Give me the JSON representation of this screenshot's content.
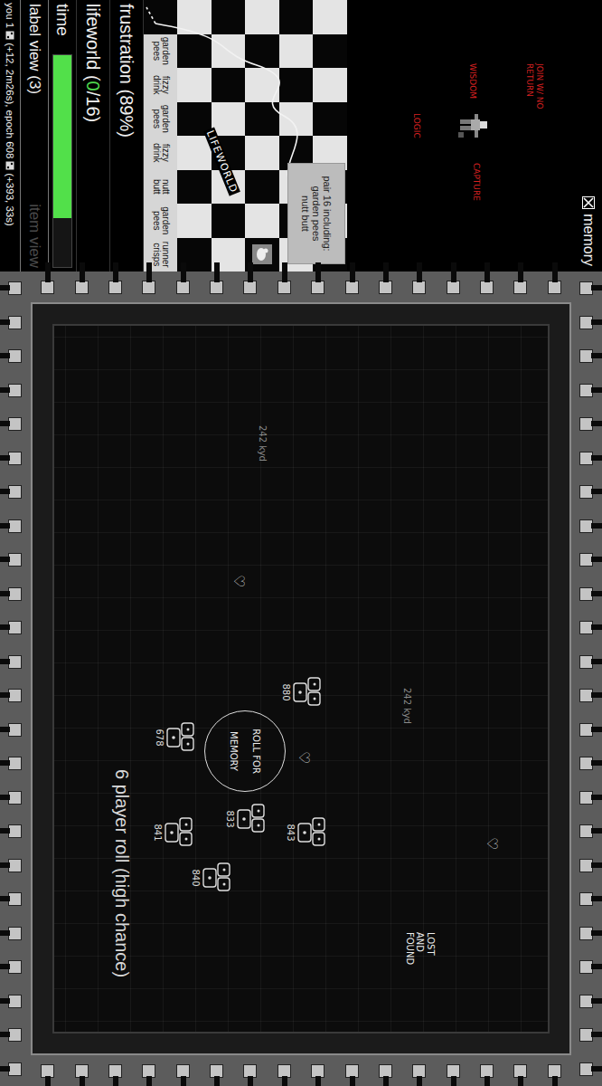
{
  "status": {
    "name": "you",
    "score": "1",
    "score_detail": "(+12, 2m26s), epoch",
    "epoch": "608",
    "epoch_detail": "(+393, 33s)"
  },
  "views": [
    {
      "label": "label view (3)",
      "selected": true
    },
    {
      "label": "item view",
      "selected": false
    }
  ],
  "time": {
    "label": "time",
    "level": 0.77
  },
  "lifeworld": {
    "prefix": "lifeworld (",
    "count": "0",
    "suffix": "/16)"
  },
  "frustration": {
    "label": "frustration (89%)"
  },
  "board": {
    "items": [
      "garden pees",
      "fizzy drink",
      "garden pees",
      "fizzy drink",
      "nutt butt",
      "garden pees",
      "runner crisps"
    ],
    "tooltip": {
      "title": "pair 16 including:",
      "items": [
        "garden pees",
        "nutt butt"
      ]
    },
    "scrawl": "LIFEWORLD"
  },
  "notes": [
    "JOIN W/ NO RETURN",
    "WISDOM",
    "CAPTURE",
    "LOGIC"
  ],
  "memory": {
    "label": "memory",
    "checked": true
  },
  "chip": {
    "title": "6 player roll (high chance)",
    "circle": [
      "ROLL FOR",
      "MEMORY"
    ],
    "lost": [
      "LOST",
      "AND",
      "FOUND"
    ],
    "figures": [
      {
        "label": "678"
      },
      {
        "label": "841"
      },
      {
        "label": "840"
      },
      {
        "label": "833"
      },
      {
        "label": "843"
      },
      {
        "label": "880"
      }
    ],
    "distances": [
      "242 kyd",
      "242 kyd"
    ],
    "hearts": [
      "♡",
      "♡",
      "♡"
    ]
  }
}
